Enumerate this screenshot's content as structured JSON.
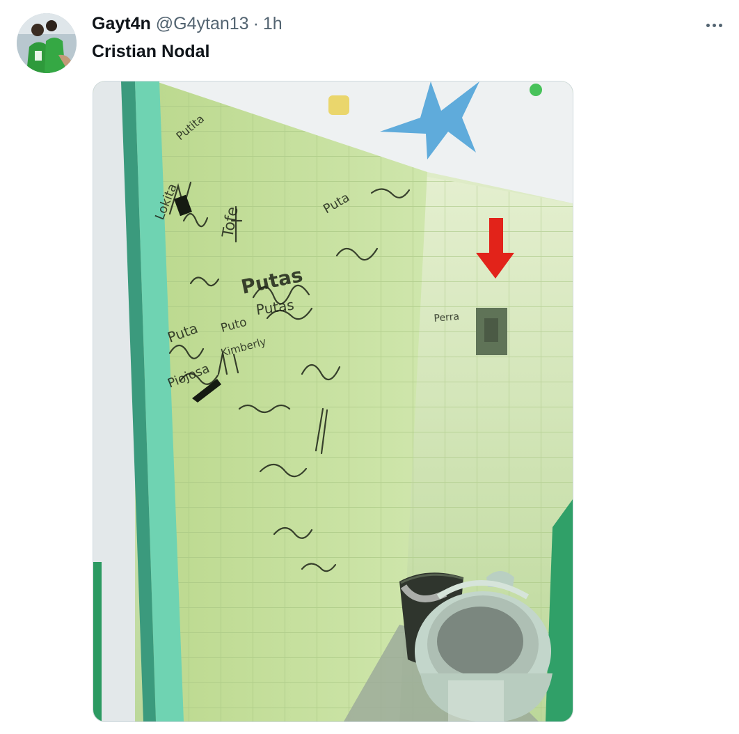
{
  "tweet": {
    "display_name": "Gayt4n",
    "handle": "@G4ytan13",
    "separator": "·",
    "time": "1h",
    "text": "Cristian Nodal"
  },
  "icons": {
    "more": "more-horizontal-icon"
  },
  "image": {
    "wall_writing_left": [
      "Putita",
      "Lokita",
      "Tofe",
      "Putas",
      "Puta",
      "Piojosa",
      "Puto",
      "Kimberly"
    ],
    "wall_writing_right": [
      "Puta",
      "Putas",
      "Perra"
    ]
  },
  "colors": {
    "text_primary": "#0f1419",
    "text_secondary": "#536471",
    "tile_green": "#c8e2a2",
    "arrow_red": "#e2231a",
    "star_blue": "#4fa3d8"
  }
}
